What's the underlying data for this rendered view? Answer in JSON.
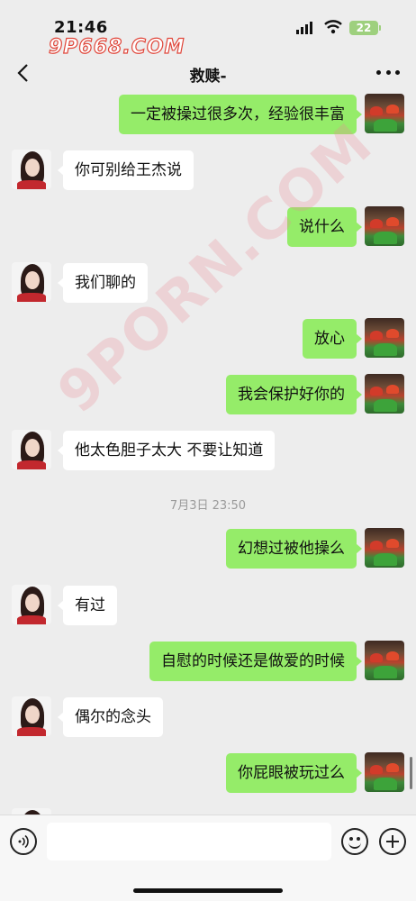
{
  "status_bar": {
    "time": "21:46",
    "battery": "22",
    "watermark": "9P668.COM"
  },
  "nav": {
    "title": "救赎-"
  },
  "watermark_diag": "9PORN.COM",
  "messages": [
    {
      "side": "right",
      "text": "一定被操过很多次，经验很丰富"
    },
    {
      "side": "left",
      "text": "你可别给王杰说"
    },
    {
      "side": "right",
      "text": "说什么"
    },
    {
      "side": "left",
      "text": "我们聊的"
    },
    {
      "side": "right",
      "text": "放心"
    },
    {
      "side": "right",
      "text": "我会保护好你的"
    },
    {
      "side": "left",
      "text": "他太色胆子太大 不要让知道"
    },
    {
      "side": "timestamp",
      "text": "7月3日 23:50"
    },
    {
      "side": "right",
      "text": "幻想过被他操么"
    },
    {
      "side": "left",
      "text": "有过"
    },
    {
      "side": "right",
      "text": "自慰的时候还是做爱的时候"
    },
    {
      "side": "left",
      "text": "偶尔的念头"
    },
    {
      "side": "right",
      "text": "你屁眼被玩过么"
    }
  ],
  "input": {
    "placeholder": ""
  },
  "colors": {
    "bubble_right": "#95ec69",
    "bubble_left": "#ffffff",
    "background": "#ededed"
  },
  "icons": [
    "back-arrow-icon",
    "more-dots-icon",
    "voice-icon",
    "emoji-icon",
    "plus-icon",
    "signal-icon",
    "wifi-icon",
    "battery-icon"
  ]
}
